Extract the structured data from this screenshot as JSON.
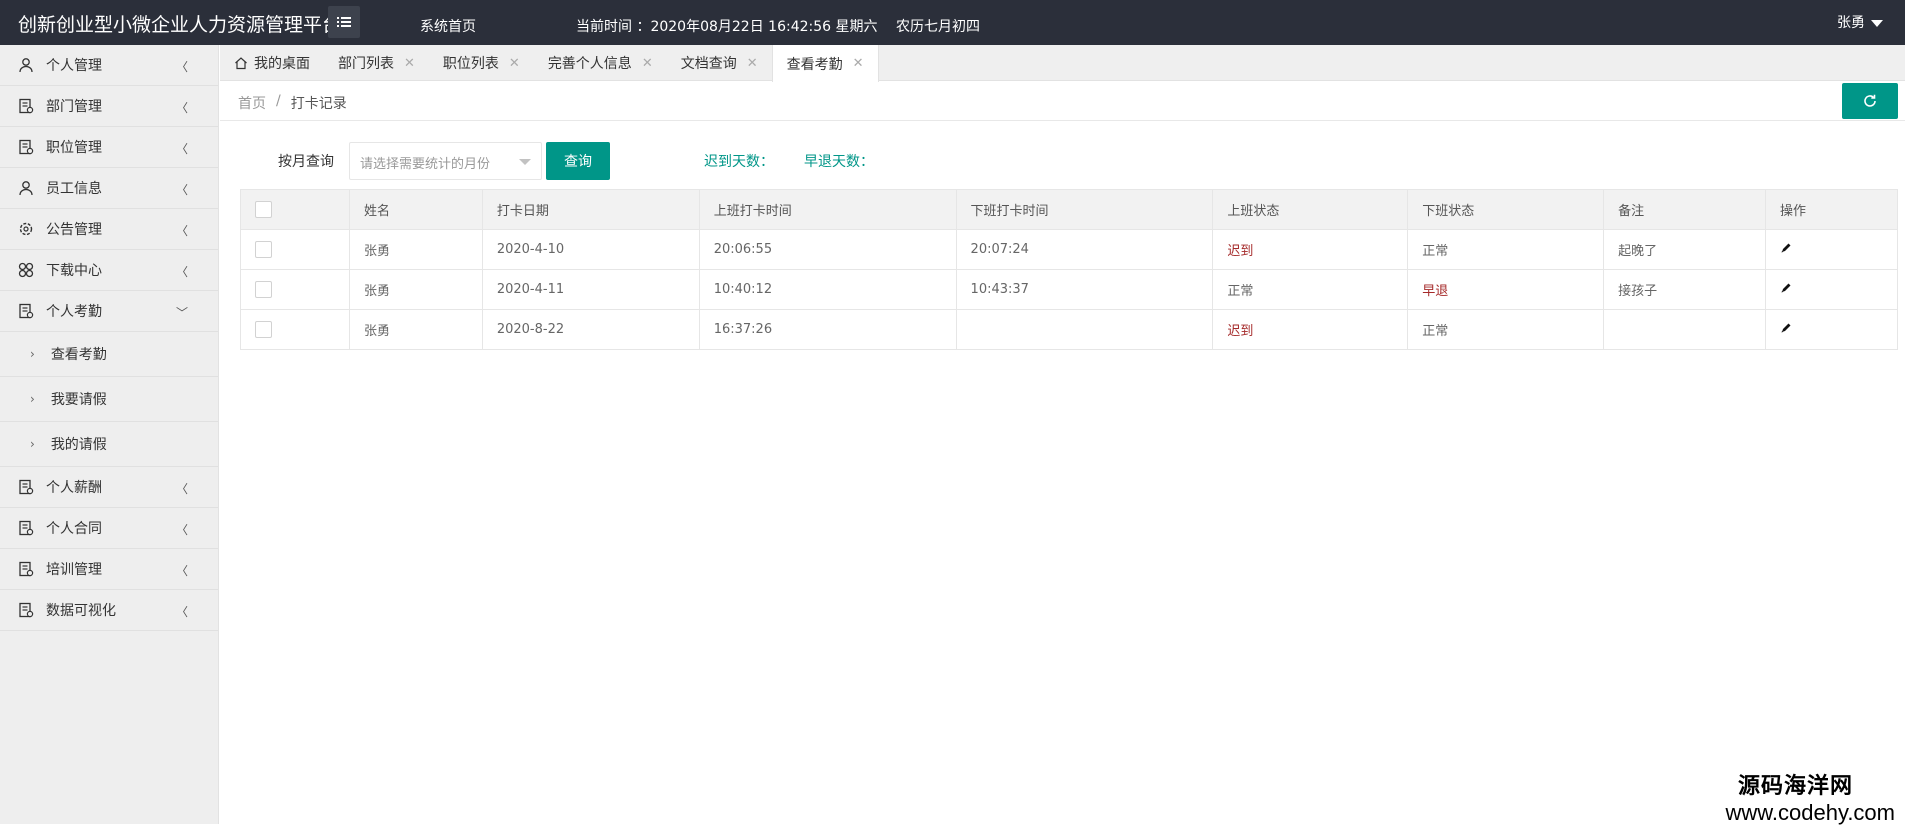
{
  "header": {
    "logo": "创新创业型小微企业人力资源管理平台",
    "home_link": "系统首页",
    "time_label": "当前时间 ：2020年08月22日 16:42:56 星期六",
    "lunar": "农历七月初四",
    "user": "张勇"
  },
  "sidebar": {
    "items": [
      {
        "label": "个人管理",
        "icon": "user-icon"
      },
      {
        "label": "部门管理",
        "icon": "doc-icon"
      },
      {
        "label": "职位管理",
        "icon": "doc-icon"
      },
      {
        "label": "员工信息",
        "icon": "user-icon"
      },
      {
        "label": "公告管理",
        "icon": "gear-icon"
      },
      {
        "label": "下载中心",
        "icon": "grid-icon"
      },
      {
        "label": "个人考勤",
        "icon": "doc-icon",
        "expanded": true,
        "children": [
          {
            "label": "查看考勤"
          },
          {
            "label": "我要请假"
          },
          {
            "label": "我的请假"
          }
        ]
      },
      {
        "label": "个人薪酬",
        "icon": "doc-icon"
      },
      {
        "label": "个人合同",
        "icon": "doc-icon"
      },
      {
        "label": "培训管理",
        "icon": "doc-icon"
      },
      {
        "label": "数据可视化",
        "icon": "doc-icon"
      }
    ]
  },
  "tabs": [
    {
      "label": "我的桌面",
      "home": true
    },
    {
      "label": "部门列表"
    },
    {
      "label": "职位列表"
    },
    {
      "label": "完善个人信息"
    },
    {
      "label": "文档查询"
    },
    {
      "label": "查看考勤",
      "active": true
    }
  ],
  "breadcrumb": {
    "home": "首页",
    "sep": "/",
    "current": "打卡记录"
  },
  "query": {
    "label": "按月查询",
    "placeholder": "请选择需要统计的月份",
    "button": "查询",
    "late_label": "迟到天数：",
    "early_label": "早退天数："
  },
  "table": {
    "headers": [
      "姓名",
      "打卡日期",
      "上班打卡时间",
      "下班打卡时间",
      "上班状态",
      "下班状态",
      "备注",
      "操作"
    ],
    "rows": [
      {
        "name": "张勇",
        "date": "2020-4-10",
        "on": "20:06:55",
        "off": "20:07:24",
        "on_status": "迟到",
        "off_status": "正常",
        "note": "起晚了"
      },
      {
        "name": "张勇",
        "date": "2020-4-11",
        "on": "10:40:12",
        "off": "10:43:37",
        "on_status": "正常",
        "off_status": "早退",
        "note": "接孩子"
      },
      {
        "name": "张勇",
        "date": "2020-8-22",
        "on": "16:37:26",
        "off": "",
        "on_status": "迟到",
        "off_status": "正常",
        "note": ""
      }
    ]
  },
  "watermark": {
    "cn": "源码海洋网",
    "en": "www.codehy.com"
  },
  "colors": {
    "header_bg": "#2b2f3a",
    "accent": "#009688",
    "danger": "#a52a2a"
  }
}
